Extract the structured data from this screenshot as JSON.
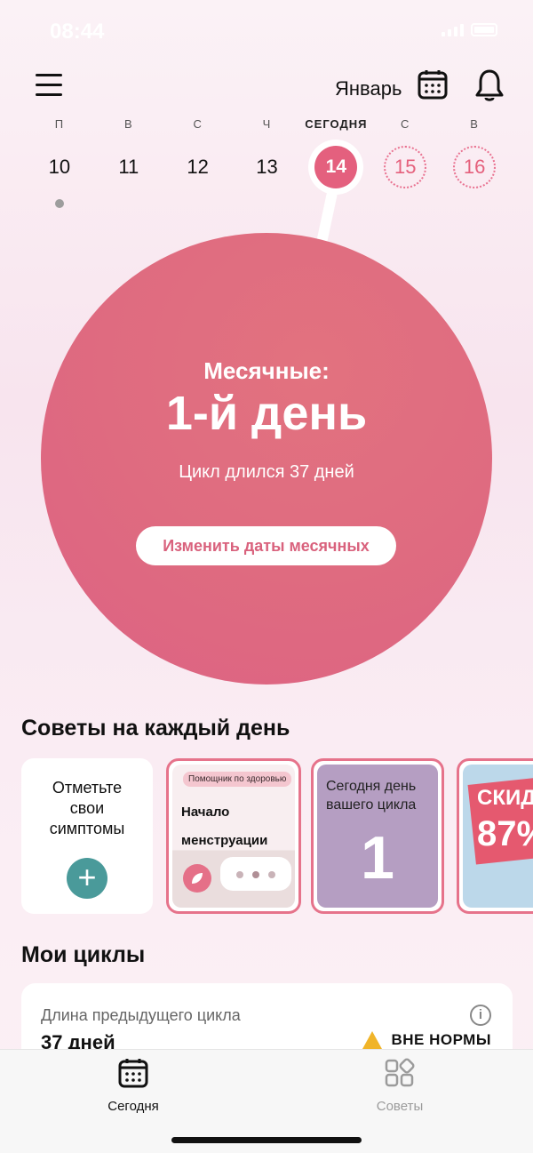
{
  "status": {
    "time": "08:44"
  },
  "header": {
    "month": "Январь",
    "icons": [
      "menu-icon",
      "calendar-icon",
      "bell-icon"
    ]
  },
  "week": [
    {
      "letter": "П",
      "num": "10",
      "state": "past-logged"
    },
    {
      "letter": "В",
      "num": "11",
      "state": "past"
    },
    {
      "letter": "С",
      "num": "12",
      "state": "past"
    },
    {
      "letter": "Ч",
      "num": "13",
      "state": "past"
    },
    {
      "letter": "СЕГОДНЯ",
      "num": "14",
      "state": "today"
    },
    {
      "letter": "С",
      "num": "15",
      "state": "future"
    },
    {
      "letter": "В",
      "num": "16",
      "state": "future"
    }
  ],
  "circle": {
    "subtitle": "Месячные:",
    "title": "1-й день",
    "note": "Цикл длился 37 дней",
    "button": "Изменить даты месячных"
  },
  "tips": {
    "title": "Советы на каждый день",
    "card1": {
      "text": "Отметьте свои симптомы",
      "button": "+"
    },
    "card2": {
      "badge": "Помощник по здоровью",
      "text_line1": "Начало",
      "text_line2": "менструации"
    },
    "card3": {
      "text": "Сегодня день вашего цикла",
      "number": "1"
    },
    "card4": {
      "text": "СКИД",
      "pct": "87%"
    }
  },
  "cycles": {
    "title": "Мои циклы",
    "label": "Длина предыдущего цикла",
    "value": "37 дней",
    "status": "ВНЕ НОРМЫ"
  },
  "tabbar": {
    "tabs": [
      {
        "label": "Сегодня",
        "active": true
      },
      {
        "label": "Советы",
        "active": false
      }
    ]
  },
  "colors": {
    "accent": "#e4607e",
    "teal": "#4a9a9a",
    "lavender": "#b59ec2",
    "warning": "#f0b429"
  }
}
